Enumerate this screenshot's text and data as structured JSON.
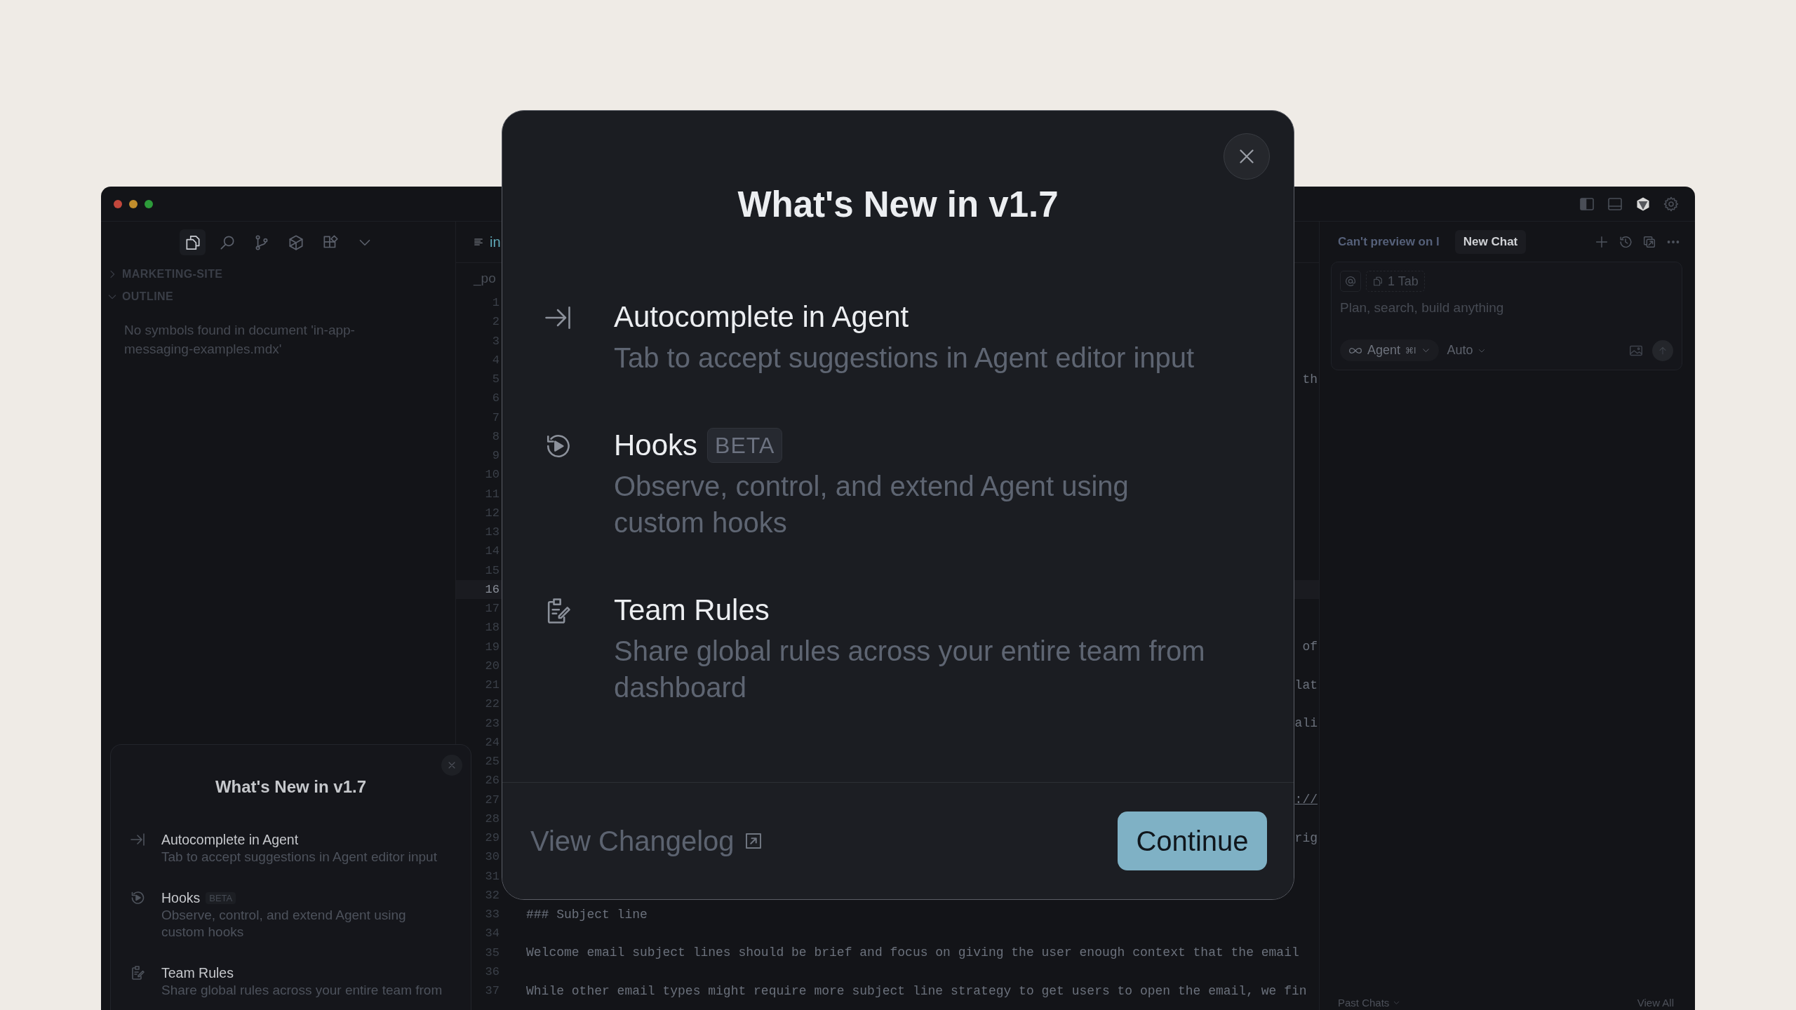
{
  "window": {
    "traffic_lights": [
      {
        "color": "#c2473c"
      },
      {
        "color": "#c18d2c"
      },
      {
        "color": "#2d9b3a"
      }
    ]
  },
  "sidebar": {
    "tools": [
      {
        "kind": "files",
        "selected": true
      },
      {
        "kind": "search",
        "selected": false
      },
      {
        "kind": "branch",
        "selected": false
      },
      {
        "kind": "cube",
        "selected": false
      },
      {
        "kind": "extensions",
        "selected": false
      },
      {
        "kind": "more",
        "selected": false
      }
    ],
    "sections": [
      {
        "label": "MARKETING-SITE",
        "expanded": false
      },
      {
        "label": "OUTLINE",
        "expanded": true
      }
    ],
    "outline_message": "No symbols found in document 'in-app-messaging-examples.mdx'"
  },
  "whats_new_toast": {
    "title": "What's New in v1.7",
    "items": [
      {
        "kind": "tab",
        "title": "Autocomplete in Agent",
        "description": "Tab to accept suggestions in Agent editor input"
      },
      {
        "kind": "hooks",
        "title": "Hooks",
        "badge": "BETA",
        "description": "Observe, control, and extend Agent using custom hooks"
      },
      {
        "kind": "rules",
        "title": "Team Rules",
        "description": "Share global rules across your entire team from"
      }
    ]
  },
  "editor": {
    "tab": "in",
    "breadcrumb": "_po",
    "lines": [
      {
        "number": "1",
        "kind": "blank",
        "current": false
      },
      {
        "number": "2",
        "kind": "blank",
        "current": false
      },
      {
        "number": "3",
        "kind": "blank",
        "current": false
      },
      {
        "number": "4",
        "kind": "blank",
        "current": false
      },
      {
        "number": "5",
        "kind": "fragment",
        "current": false,
        "text": "th",
        "link": false
      },
      {
        "number": "6",
        "kind": "blank",
        "current": false
      },
      {
        "number": "7",
        "kind": "blank",
        "current": false
      },
      {
        "number": "8",
        "kind": "blank",
        "current": false
      },
      {
        "number": "9",
        "kind": "blank",
        "current": false
      },
      {
        "number": "10",
        "kind": "blank",
        "current": false
      },
      {
        "number": "11",
        "kind": "blank",
        "current": false
      },
      {
        "number": "12",
        "kind": "blank",
        "current": false
      },
      {
        "number": "13",
        "kind": "blank",
        "current": false
      },
      {
        "number": "14",
        "kind": "blank",
        "current": false
      },
      {
        "number": "15",
        "kind": "blank",
        "current": false
      },
      {
        "number": "16",
        "kind": "blank",
        "current": true
      },
      {
        "number": "17",
        "kind": "blank",
        "current": false
      },
      {
        "number": "18",
        "kind": "blank",
        "current": false
      },
      {
        "number": "19",
        "kind": "fragment",
        "current": false,
        "text": "of",
        "link": false
      },
      {
        "number": "20",
        "kind": "blank",
        "current": false
      },
      {
        "number": "21",
        "kind": "fragment",
        "current": false,
        "text": "lat",
        "link": false
      },
      {
        "number": "22",
        "kind": "blank",
        "current": false
      },
      {
        "number": "23",
        "kind": "fragment",
        "current": false,
        "text": "ali",
        "link": false
      },
      {
        "number": "24",
        "kind": "blank",
        "current": false
      },
      {
        "number": "25",
        "kind": "blank",
        "current": false
      },
      {
        "number": "26",
        "kind": "blank",
        "current": false
      },
      {
        "number": "27",
        "kind": "fragment",
        "current": false,
        "text": "://",
        "link": true
      },
      {
        "number": "28",
        "kind": "blank",
        "current": false
      },
      {
        "number": "29",
        "kind": "fragment",
        "current": false,
        "text": "rig",
        "link": false
      },
      {
        "number": "30",
        "kind": "blank",
        "current": false
      },
      {
        "number": "31",
        "kind": "blank",
        "current": false
      },
      {
        "number": "32",
        "kind": "blank",
        "current": false
      },
      {
        "number": "33",
        "kind": "full",
        "current": false,
        "text": "### Subject line",
        "link": false
      },
      {
        "number": "34",
        "kind": "blank",
        "current": false
      },
      {
        "number": "35",
        "kind": "full",
        "current": false,
        "text": "Welcome email subject lines should be brief and focus on giving the user enough context that the email",
        "link": false
      },
      {
        "number": "36",
        "kind": "blank",
        "current": false
      },
      {
        "number": "37",
        "kind": "full",
        "current": false,
        "text": "While other email types might require more subject line strategy to get users to open the email, we fin",
        "link": false
      }
    ]
  },
  "chat": {
    "tabs": [
      {
        "label": "Can't preview on l",
        "selected": false
      },
      {
        "label": "New Chat",
        "selected": true
      }
    ],
    "context_chip": "1 Tab",
    "placeholder": "Plan, search, build anything",
    "mode": "Agent",
    "shortcut": "⌘I",
    "model": "Auto",
    "past_chats": "Past Chats",
    "view_all": "View All"
  },
  "modal": {
    "title": "What's New in v1.7",
    "items": [
      {
        "kind": "tab",
        "title": "Autocomplete in Agent",
        "description": "Tab to accept suggestions in Agent editor input"
      },
      {
        "kind": "hooks",
        "title": "Hooks",
        "badge": "BETA",
        "description": "Observe, control, and extend Agent using custom hooks"
      },
      {
        "kind": "rules",
        "title": "Team Rules",
        "description": "Share global rules across your entire team from dashboard"
      }
    ],
    "changelog_link": "View Changelog",
    "continue_button": "Continue"
  }
}
